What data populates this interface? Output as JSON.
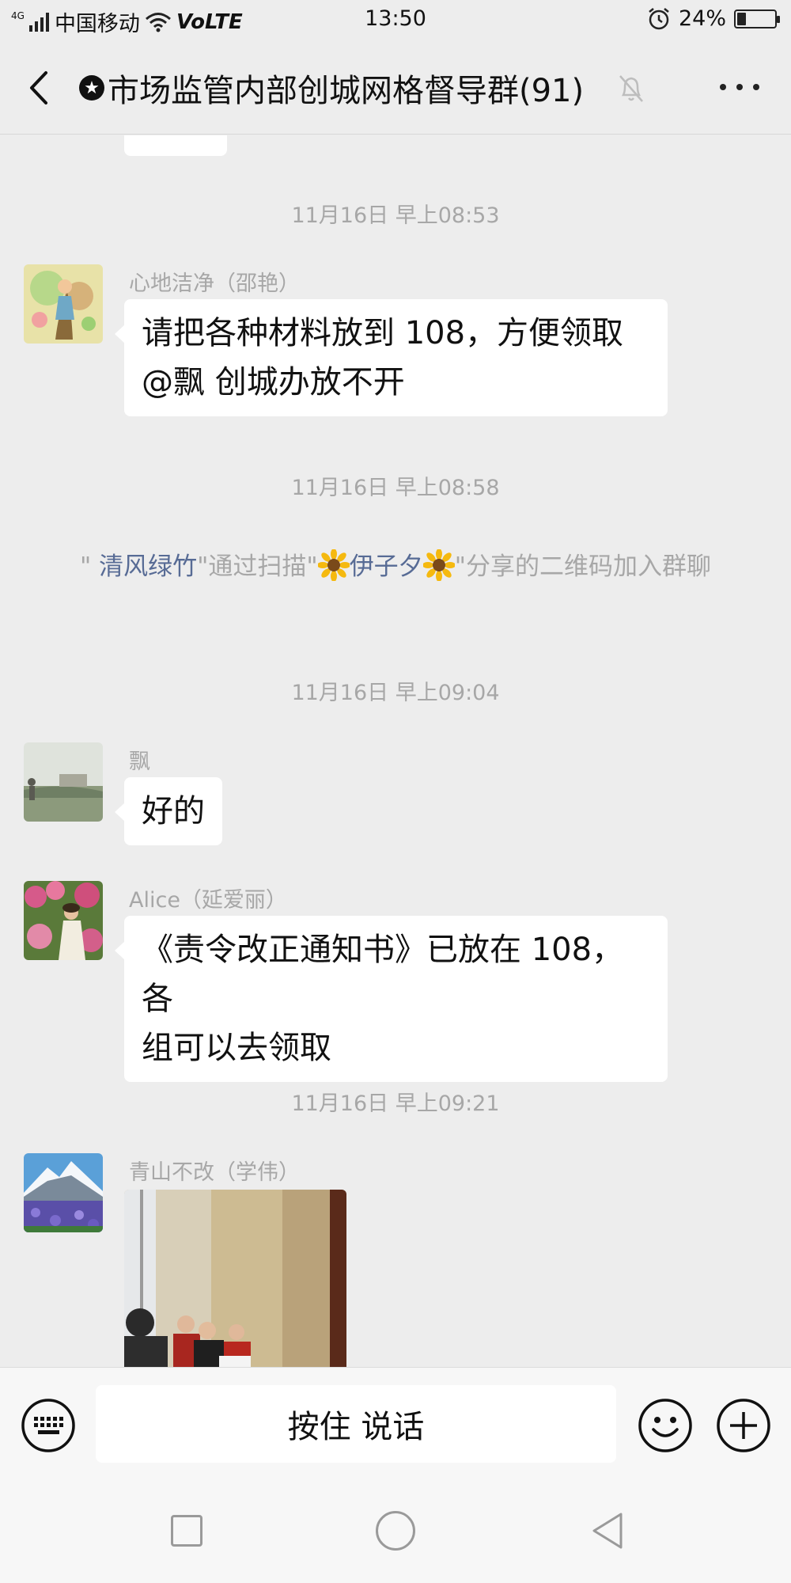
{
  "status_bar": {
    "network_tag": "4G",
    "carrier": "中国移动",
    "volte": "VoLTE",
    "time": "13:50",
    "battery_percent_label": "24%",
    "battery_level": 0.24
  },
  "header": {
    "star": "★",
    "title": "市场监管内部创城网格督导群(91)"
  },
  "messages": {
    "t1": "11月16日 早上08:53",
    "m1_sender": "心地洁净（邵艳）",
    "m1_line1": "请把各种材料放到 108，方便领取",
    "m1_line2": "@飘  创城办放不开",
    "t2": "11月16日 早上08:58",
    "sys_q1": "\" ",
    "sys_name1": "清风绿竹",
    "sys_mid": "\"通过扫描\"",
    "sys_name2": "伊子夕",
    "sys_tail": "\"分享的二维码加入群聊",
    "t3": "11月16日 早上09:04",
    "m2_sender": "飘",
    "m2_text": "好的",
    "m3_sender": "Alice（延爱丽）",
    "m3_line1": "《责令改正通知书》已放在 108，各",
    "m3_line2": "组可以去领取",
    "t4": "11月16日 早上09:21",
    "m4_sender": "青山不改（学伟）"
  },
  "input_bar": {
    "voice_label": "按住 说话"
  },
  "icons": {
    "back": "back-icon",
    "mute": "mute-bell-icon",
    "more": "more-icon",
    "keyboard": "keyboard-icon",
    "emoji": "emoji-icon",
    "plus": "plus-icon"
  }
}
